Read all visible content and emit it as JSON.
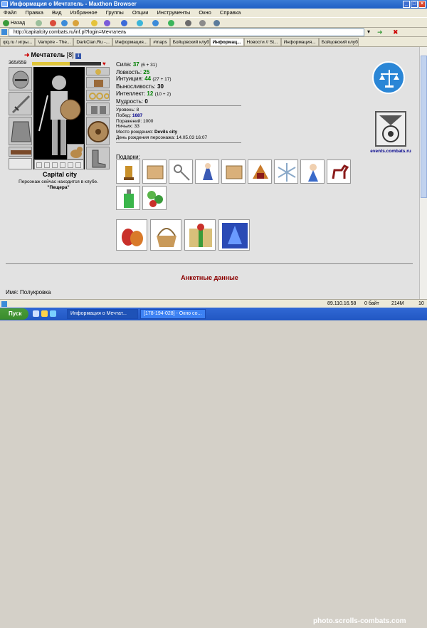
{
  "window": {
    "title": "Информация о Мечтатель - Maxthon Browser"
  },
  "menu": [
    "Файл",
    "Правка",
    "Вид",
    "Избранное",
    "Группы",
    "Опции",
    "Инструменты",
    "Окно",
    "Справка"
  ],
  "toolbar": {
    "back": "Назад"
  },
  "address": {
    "url": "http://capitalcity.combats.ru/inf.pl?login=Мечтатель"
  },
  "tabs": [
    "qiq.ru / игры...",
    "Vampire - The...",
    "DarkClan.Ru -...",
    "Информация...",
    "#maps",
    "Бойцовский клуб",
    "Информац...",
    "Новости // St...",
    "Информация...",
    "Бойцовский клуб"
  ],
  "character": {
    "name": "Мечтатель",
    "level": "[8]",
    "hp": "365/659",
    "hp_fraction": 0.55,
    "city": "Capital city",
    "location_text": "Персонаж сейчас находится в клубе.",
    "location_room": "\"Пещера\""
  },
  "stats": [
    {
      "label": "Сила:",
      "value": "37",
      "extra": "(6 + 31)",
      "color": "green"
    },
    {
      "label": "Ловкость:",
      "value": "25",
      "extra": "",
      "color": "green"
    },
    {
      "label": "Интуиция:",
      "value": "44",
      "extra": "(27 + 17)",
      "color": "green"
    },
    {
      "label": "Выносливость:",
      "value": "30",
      "extra": "",
      "color": "black"
    },
    {
      "label": "Интеллект:",
      "value": "12",
      "extra": "(10 + 2)",
      "color": "green"
    },
    {
      "label": "Мудрость:",
      "value": "0",
      "extra": "",
      "color": "black"
    }
  ],
  "info": {
    "level_label": "Уровень:",
    "level": "8",
    "wins_label": "Побед:",
    "wins": "1687",
    "losses_label": "Поражений:",
    "losses": "1000",
    "draws_label": "Ничьих:",
    "draws": "33",
    "birthplace_label": "Место рождения:",
    "birthplace": "Devils city",
    "birthday_label": "День рождения персонажа:",
    "birthday": "14.05.03 16:07"
  },
  "gifts_label": "Подарки:",
  "events_text": "events.combats.ru",
  "anketa": {
    "title": "Анкетные данные",
    "name_line": "Имя: Полукровка"
  },
  "statusbar": {
    "ip": "89.110.16.58",
    "bytes": "0 байт",
    "mem": "214M",
    "num": "10"
  },
  "taskbar": {
    "start": "Пуск",
    "task1": "Информация о Мечтат...",
    "task2": "[178-194-028] - Окно со..."
  },
  "watermark": "photo.scrolls-combats.com",
  "colors": {
    "accent_title": "#8b0000",
    "stat_green": "#008000",
    "link_blue": "#00008b"
  }
}
